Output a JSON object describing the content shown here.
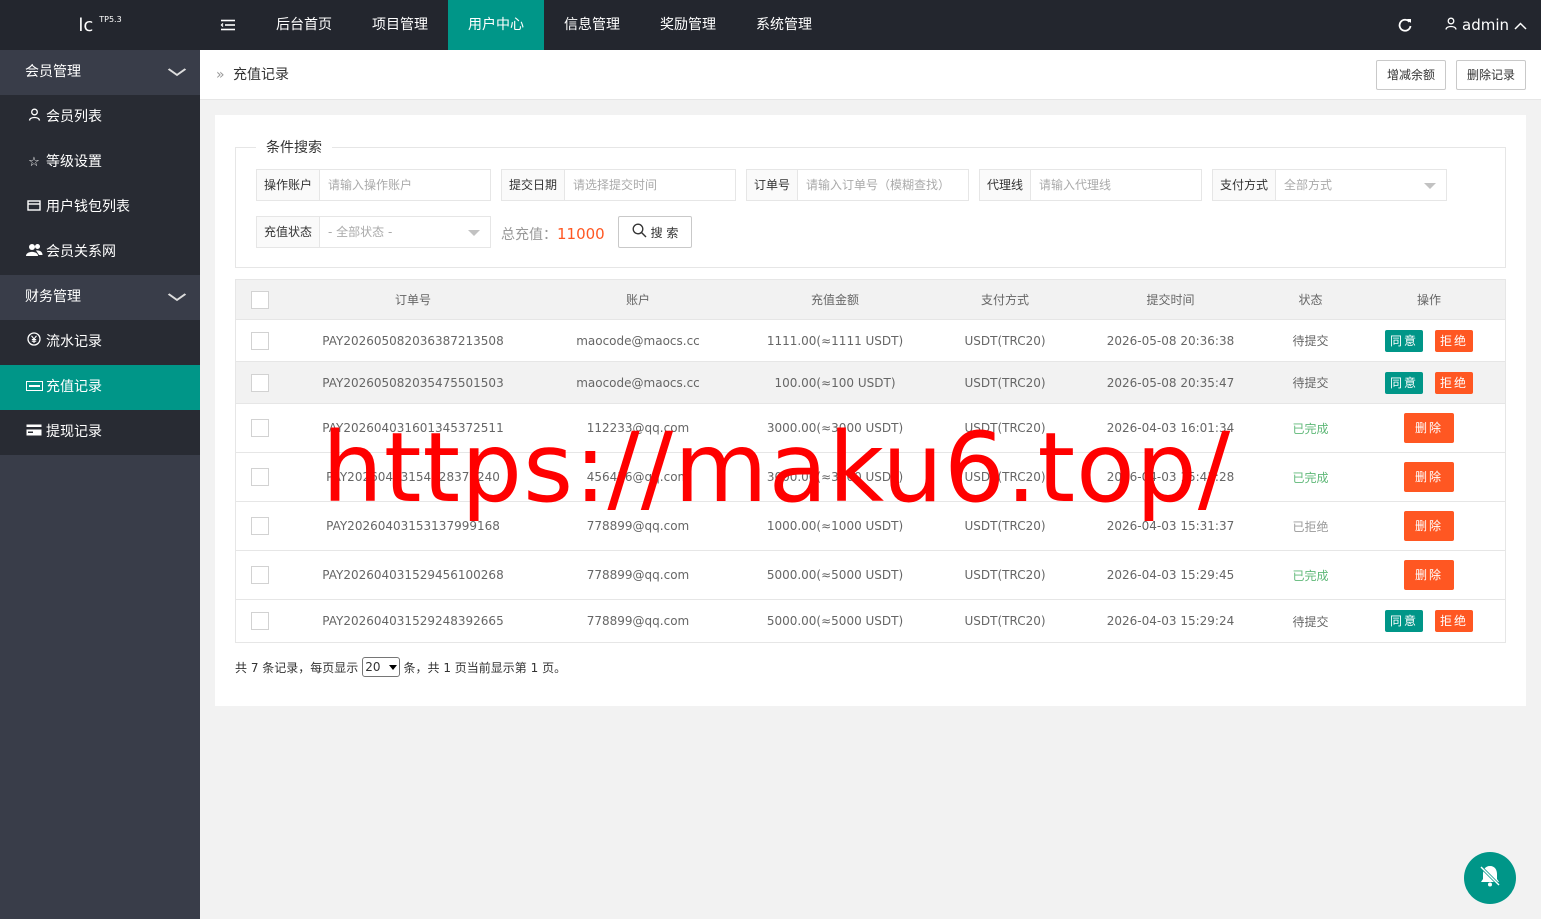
{
  "logo": {
    "name": "lc",
    "version": "TP5.3"
  },
  "header": {
    "nav": [
      "后台首页",
      "项目管理",
      "用户中心",
      "信息管理",
      "奖励管理",
      "系统管理"
    ],
    "active_index": 2,
    "user": "admin"
  },
  "sidebar": {
    "group1": {
      "title": "会员管理",
      "items": [
        "会员列表",
        "等级设置",
        "用户钱包列表",
        "会员关系网"
      ]
    },
    "group2": {
      "title": "财务管理",
      "items": [
        "流水记录",
        "充值记录",
        "提现记录"
      ]
    },
    "active_item": "充值记录"
  },
  "breadcrumb": {
    "sep": "»",
    "title": "充值记录"
  },
  "toolbar": {
    "adjust_label": "增减余额",
    "delete_label": "删除记录"
  },
  "search": {
    "legend": "条件搜索",
    "account": {
      "label": "操作账户",
      "placeholder": "请输入操作账户"
    },
    "date": {
      "label": "提交日期",
      "placeholder": "请选择提交时间"
    },
    "order": {
      "label": "订单号",
      "placeholder": "请输入订单号（模糊查找）"
    },
    "agent": {
      "label": "代理线",
      "placeholder": "请输入代理线"
    },
    "pay": {
      "label": "支付方式",
      "value": "全部方式"
    },
    "status": {
      "label": "充值状态",
      "value": "- 全部状态 -"
    },
    "total_label": "总充值：",
    "total_value": "11000",
    "search_label": "搜 索"
  },
  "table": {
    "headers": [
      "订单号",
      "账户",
      "充值金额",
      "支付方式",
      "提交时间",
      "状态",
      "操作"
    ],
    "rows": [
      {
        "order": "PAY20260508203638721350",
        "order_tail": "8",
        "account": "maocode@maocs.cc",
        "amount": "1111.00(≈1111 USDT)",
        "pay": "USDT(TRC20)",
        "time": "2026-05-08 20:36:38",
        "status": "待提交",
        "status_type": "pend",
        "actions": [
          "同意",
          "拒绝"
        ]
      },
      {
        "order": "PAY20260508203547550150",
        "order_tail": "3",
        "account": "maocode@maocs.cc",
        "amount": "100.00(≈100 USDT)",
        "pay": "USDT(TRC20)",
        "time": "2026-05-08 20:35:47",
        "status": "待提交",
        "status_type": "pend",
        "actions": [
          "同意",
          "拒绝"
        ]
      },
      {
        "order": "PAY20260403160134537251",
        "order_tail": "1",
        "account": "112233@qq.com",
        "amount": "3000.00(≈3000 USDT)",
        "pay": "USDT(TRC20)",
        "time": "2026-04-03 16:01:34",
        "status": "已完成",
        "status_type": "ok",
        "actions": [
          "删除"
        ]
      },
      {
        "order": "PAY2026040315412837824",
        "order_tail": "0",
        "account": "456456@qq.com",
        "amount": "3000.00(≈3000 USDT)",
        "pay": "USDT(TRC20)",
        "time": "2026-04-03 15:41:28",
        "status": "已完成",
        "status_type": "ok",
        "actions": [
          "删除"
        ]
      },
      {
        "order": "PAY2026040315313799916",
        "order_tail": "8",
        "account": "778899@qq.com",
        "amount": "1000.00(≈1000 USDT)",
        "pay": "USDT(TRC20)",
        "time": "2026-04-03 15:31:37",
        "status": "已拒绝",
        "status_type": "rej",
        "actions": [
          "删除"
        ]
      },
      {
        "order": "PAY20260403152945610026",
        "order_tail": "8",
        "account": "778899@qq.com",
        "amount": "5000.00(≈5000 USDT)",
        "pay": "USDT(TRC20)",
        "time": "2026-04-03 15:29:45",
        "status": "已完成",
        "status_type": "ok",
        "actions": [
          "删除"
        ]
      },
      {
        "order": "PAY20260403152924839266",
        "order_tail": "5",
        "account": "778899@qq.com",
        "amount": "5000.00(≈5000 USDT)",
        "pay": "USDT(TRC20)",
        "time": "2026-04-03 15:29:24",
        "status": "待提交",
        "status_type": "pend",
        "actions": [
          "同意",
          "拒绝"
        ]
      }
    ]
  },
  "pager": {
    "prefix": "共 7 条记录，每页显示",
    "page_size": "20",
    "suffix": "条，共 1 页当前显示第 1 页。"
  },
  "watermark": "https://maku6.top/",
  "colors": {
    "primary": "#009688",
    "danger": "#ff5722",
    "sidebar": "#393d49",
    "header": "#23262e"
  }
}
